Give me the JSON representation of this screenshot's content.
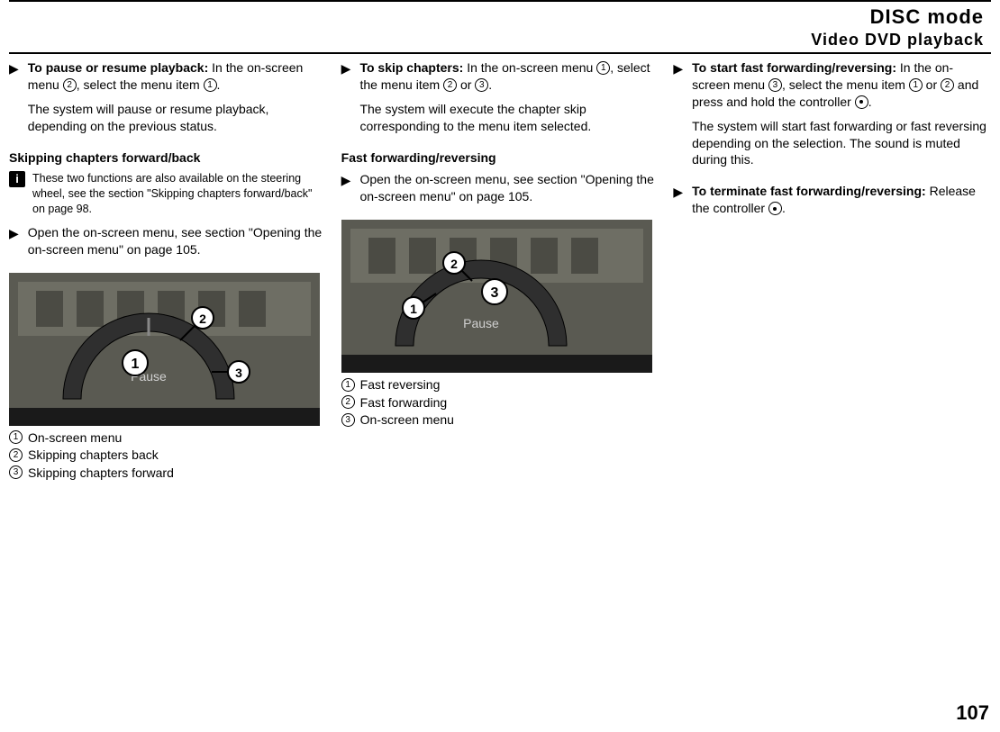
{
  "header": {
    "title": "DISC mode",
    "subtitle": "Video DVD playback"
  },
  "col1": {
    "step1_bold": "To pause or resume playback:",
    "step1_rest1": " In the on-screen menu ",
    "step1_rest2": ", select the menu item ",
    "step1_rest3": ".",
    "step1_p2": "The system will pause or resume playback, depending on the previous status.",
    "subhead": "Skipping chapters forward/back",
    "info": "These two functions are also available on the steering wheel, see the section \"Skipping chapters forward/back\" on page 98.",
    "step2": "Open the on-screen menu, see section \"Opening the on-screen menu\" on page 105.",
    "legend": {
      "l1": "On-screen menu",
      "l2": "Skipping chapters back",
      "l3": "Skipping chapters forward"
    }
  },
  "col2": {
    "step1_bold": "To skip chapters:",
    "step1_rest1": " In the on-screen menu ",
    "step1_rest2": ", select the menu item ",
    "step1_rest3": " or ",
    "step1_rest4": ".",
    "step1_p2": "The system will execute the chapter skip corresponding to the menu item selected.",
    "subhead": "Fast forwarding/reversing",
    "step2": "Open the on-screen menu, see section \"Opening the on-screen menu\" on page 105.",
    "legend": {
      "l1": "Fast reversing",
      "l2": "Fast forwarding",
      "l3": "On-screen menu"
    }
  },
  "col3": {
    "step1_bold": "To start fast forwarding/reversing:",
    "step1_rest1": " In the on-screen menu ",
    "step1_rest2": ", select the menu item ",
    "step1_rest3": " or ",
    "step1_rest4": " and press and hold the controller ",
    "step1_rest5": ".",
    "step1_p2": "The system will start fast forwarding or fast reversing depending on the selection. The sound is muted during this.",
    "step2_bold": "To terminate fast forwarding/reversing:",
    "step2_rest1": " Release the controller ",
    "step2_rest2": "."
  },
  "page_number": "107",
  "fig_label": "Pause"
}
